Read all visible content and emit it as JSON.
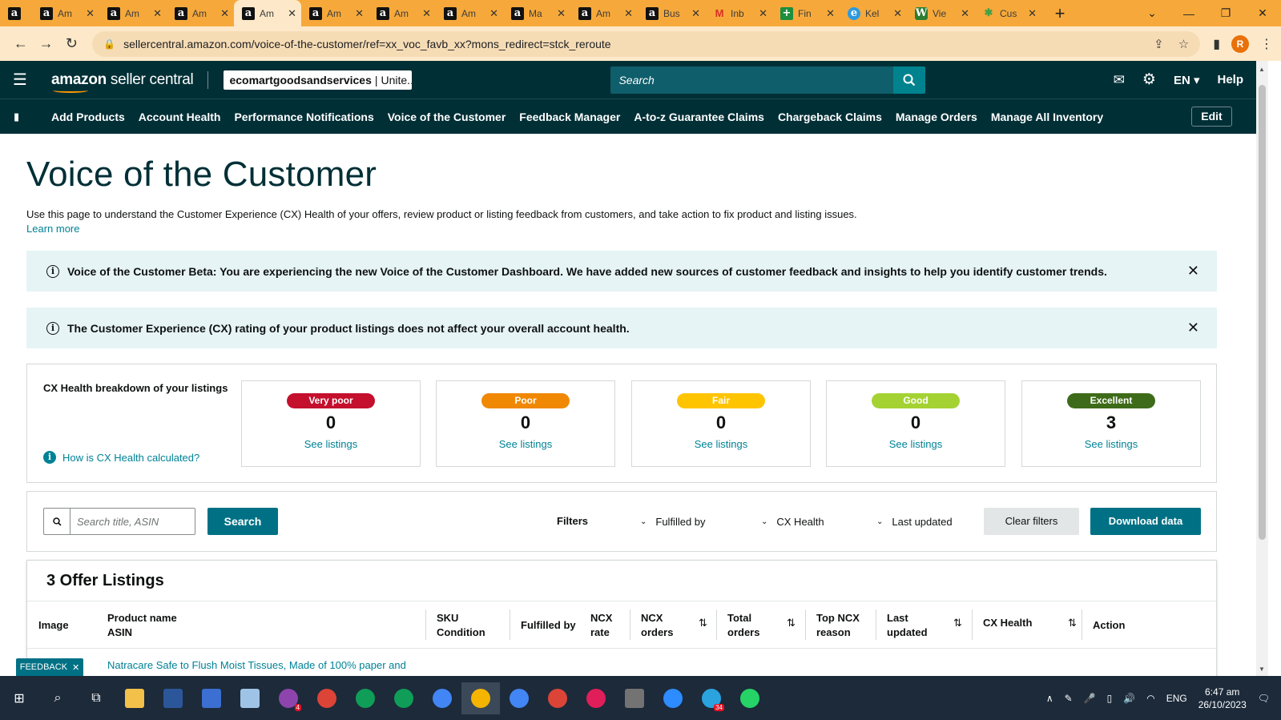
{
  "browser": {
    "tabs": [
      {
        "title": "",
        "fav": "a",
        "kind": "amazon"
      },
      {
        "title": "Am",
        "fav": "a",
        "kind": "amazon"
      },
      {
        "title": "Am",
        "fav": "a",
        "kind": "amazon"
      },
      {
        "title": "Am",
        "fav": "a",
        "kind": "amazon"
      },
      {
        "title": "Am",
        "fav": "a",
        "kind": "amazon",
        "active": true
      },
      {
        "title": "Am",
        "fav": "a",
        "kind": "amazon"
      },
      {
        "title": "Am",
        "fav": "a",
        "kind": "amazon"
      },
      {
        "title": "Am",
        "fav": "a",
        "kind": "amazon"
      },
      {
        "title": "Ma",
        "fav": "a",
        "kind": "amazon"
      },
      {
        "title": "Am",
        "fav": "a",
        "kind": "amazon"
      },
      {
        "title": "Bus",
        "fav": "a",
        "kind": "amazon"
      },
      {
        "title": "Inb",
        "fav": "M",
        "kind": "gm"
      },
      {
        "title": "Fin",
        "fav": "+",
        "kind": "sh"
      },
      {
        "title": "Kel",
        "fav": "e",
        "kind": "ke"
      },
      {
        "title": "Vie",
        "fav": "W",
        "kind": "w"
      },
      {
        "title": "Cus",
        "fav": "✱",
        "kind": "cu"
      }
    ],
    "url": "sellercentral.amazon.com/voice-of-the-customer/ref=xx_voc_favb_xx?mons_redirect=stck_reroute",
    "profile_initial": "R"
  },
  "header": {
    "logo_amazon": "amazon",
    "logo_sc": " seller central",
    "store_name": "ecomartgoodsandservices",
    "store_region": "Unite...",
    "search_placeholder": "Search",
    "lang": "EN",
    "help": "Help"
  },
  "nav": {
    "items": [
      "Add Products",
      "Account Health",
      "Performance Notifications",
      "Voice of the Customer",
      "Feedback Manager",
      "A-to-z Guarantee Claims",
      "Chargeback Claims",
      "Manage Orders",
      "Manage All Inventory"
    ],
    "edit": "Edit"
  },
  "page": {
    "title": "Voice of the Customer",
    "intro": "Use this page to understand the Customer Experience (CX) Health of your offers, review product or listing feedback from customers, and take action to fix product and listing issues.",
    "learn_more": "Learn more"
  },
  "alerts": [
    {
      "text": "Voice of the Customer Beta: You are experiencing the new Voice of the Customer Dashboard. We have added new sources of customer feedback and insights to help you identify customer trends."
    },
    {
      "text": "The Customer Experience (CX) rating of your product listings does not affect your overall account health."
    }
  ],
  "cx": {
    "title": "CX Health breakdown of your listings",
    "how_link": "How is CX Health calculated?",
    "cards": [
      {
        "label": "Very poor",
        "count": "0",
        "link": "See listings",
        "color": "#c40f2d"
      },
      {
        "label": "Poor",
        "count": "0",
        "link": "See listings",
        "color": "#f08804"
      },
      {
        "label": "Fair",
        "count": "0",
        "link": "See listings",
        "color": "#ffc400"
      },
      {
        "label": "Good",
        "count": "0",
        "link": "See listings",
        "color": "#a4d233"
      },
      {
        "label": "Excellent",
        "count": "3",
        "link": "See listings",
        "color": "#3e6b19"
      }
    ]
  },
  "filters": {
    "search_placeholder": "Search title, ASIN",
    "search_btn": "Search",
    "label": "Filters",
    "dropdowns": [
      "Fulfilled by",
      "CX Health",
      "Last updated"
    ],
    "clear": "Clear filters",
    "download": "Download data"
  },
  "listings": {
    "title": "3 Offer Listings",
    "columns": {
      "image": "Image",
      "product_l1": "Product name",
      "product_l2": "ASIN",
      "sku_l1": "SKU",
      "sku_l2": "Condition",
      "fulfilled": "Fulfilled by",
      "ncx_rate_l1": "NCX",
      "ncx_rate_l2": "rate",
      "ncx_orders_l1": "NCX",
      "ncx_orders_l2": "orders",
      "total_l1": "Total",
      "total_l2": "orders",
      "top_l1": "Top NCX",
      "top_l2": "reason",
      "last_l1": "Last",
      "last_l2": "updated",
      "cx_health": "CX Health",
      "action": "Action"
    },
    "first_row_product": "Natracare Safe to Flush Moist Tissues, Made of 100% paper and"
  },
  "feedback_tab": "FEEDBACK",
  "taskbar": {
    "time": "6:47 am",
    "date": "26/10/2023",
    "lang": "ENG"
  }
}
